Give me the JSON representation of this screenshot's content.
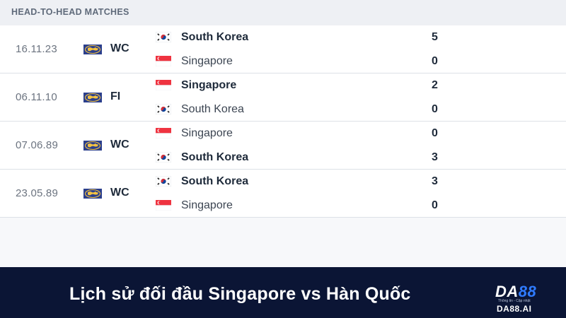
{
  "section_title": "HEAD-TO-HEAD MATCHES",
  "colors": {
    "win_text": "#1e2a3a",
    "loss_text": "#3c4552",
    "banner_bg": "#0b1535",
    "logo_accent": "#2f7bff"
  },
  "icons": {
    "competition": "world-cup-globe-icon",
    "south_korea": "south-korea-flag-icon",
    "singapore": "singapore-flag-icon"
  },
  "matches": [
    {
      "date": "16.11.23",
      "competition": "WC",
      "home": {
        "name": "South Korea",
        "score": "5",
        "flag": "kr",
        "winner": true
      },
      "away": {
        "name": "Singapore",
        "score": "0",
        "flag": "sg",
        "winner": false
      }
    },
    {
      "date": "06.11.10",
      "competition": "FI",
      "home": {
        "name": "Singapore",
        "score": "2",
        "flag": "sg",
        "winner": true
      },
      "away": {
        "name": "South Korea",
        "score": "0",
        "flag": "kr",
        "winner": false
      }
    },
    {
      "date": "07.06.89",
      "competition": "WC",
      "home": {
        "name": "Singapore",
        "score": "0",
        "flag": "sg",
        "winner": false
      },
      "away": {
        "name": "South Korea",
        "score": "3",
        "flag": "kr",
        "winner": true
      }
    },
    {
      "date": "23.05.89",
      "competition": "WC",
      "home": {
        "name": "South Korea",
        "score": "3",
        "flag": "kr",
        "winner": true
      },
      "away": {
        "name": "Singapore",
        "score": "0",
        "flag": "sg",
        "winner": false
      }
    }
  ],
  "banner": {
    "caption": "Lịch sử đối đầu Singapore vs Hàn Quốc"
  },
  "logo": {
    "prefix": "DA",
    "suffix": "88",
    "tagline": "Thông tin - Cập nhật",
    "url": "DA88.AI"
  }
}
